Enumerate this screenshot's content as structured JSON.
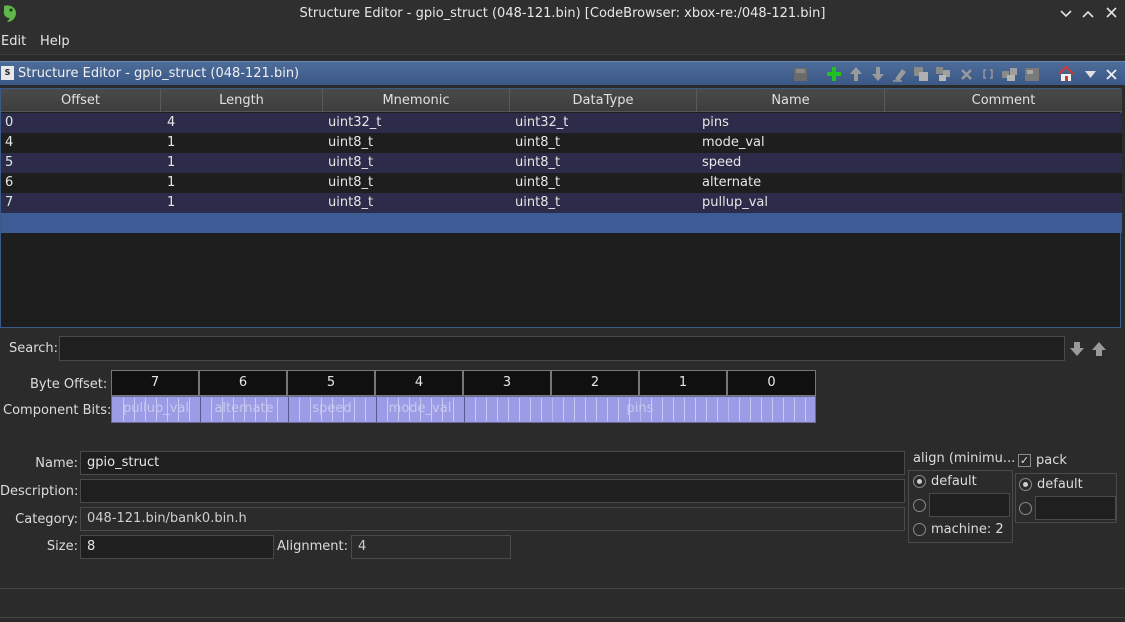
{
  "window": {
    "title": "Structure Editor - gpio_struct (048-121.bin) [CodeBrowser: xbox-re:/048-121.bin]"
  },
  "menu": {
    "items": [
      {
        "label": "Edit"
      },
      {
        "label": "Help"
      }
    ]
  },
  "panel": {
    "title": "Structure Editor - gpio_struct (048-121.bin)",
    "icon_text": "S"
  },
  "table": {
    "headers": [
      "Offset",
      "Length",
      "Mnemonic",
      "DataType",
      "Name",
      "Comment"
    ],
    "rows": [
      {
        "offset": "0",
        "length": "4",
        "mnemonic": "uint32_t",
        "datatype": "uint32_t",
        "name": "pins",
        "comment": ""
      },
      {
        "offset": "4",
        "length": "1",
        "mnemonic": "uint8_t",
        "datatype": "uint8_t",
        "name": "mode_val",
        "comment": ""
      },
      {
        "offset": "5",
        "length": "1",
        "mnemonic": "uint8_t",
        "datatype": "uint8_t",
        "name": "speed",
        "comment": ""
      },
      {
        "offset": "6",
        "length": "1",
        "mnemonic": "uint8_t",
        "datatype": "uint8_t",
        "name": "alternate",
        "comment": ""
      },
      {
        "offset": "7",
        "length": "1",
        "mnemonic": "uint8_t",
        "datatype": "uint8_t",
        "name": "pullup_val",
        "comment": ""
      }
    ]
  },
  "search": {
    "label": "Search:",
    "value": ""
  },
  "bit_view": {
    "byte_offset_label": "Byte Offset:",
    "component_bits_label": "Component Bits:",
    "byte_offsets": [
      "7",
      "6",
      "5",
      "4",
      "3",
      "2",
      "1",
      "0"
    ],
    "components": [
      "pullup_val",
      "alternate",
      "speed",
      "mode_val",
      "pins"
    ]
  },
  "form": {
    "name_label": "Name:",
    "name_value": "gpio_struct",
    "description_label": "Description:",
    "description_value": "",
    "category_label": "Category:",
    "category_value": "048-121.bin/bank0.bin.h",
    "size_label": "Size:",
    "size_value": "8",
    "alignment_label": "Alignment:",
    "alignment_value": "4"
  },
  "align": {
    "title": "align (minimu...",
    "default_label": "default",
    "machine_label": "machine: 2",
    "custom_value": ""
  },
  "pack": {
    "label": "pack",
    "checked": true,
    "default_label": "default",
    "custom_value": ""
  },
  "colors": {
    "accent": "#3d5c96",
    "bits": "#9c9ce6",
    "add_green": "#22c022"
  }
}
